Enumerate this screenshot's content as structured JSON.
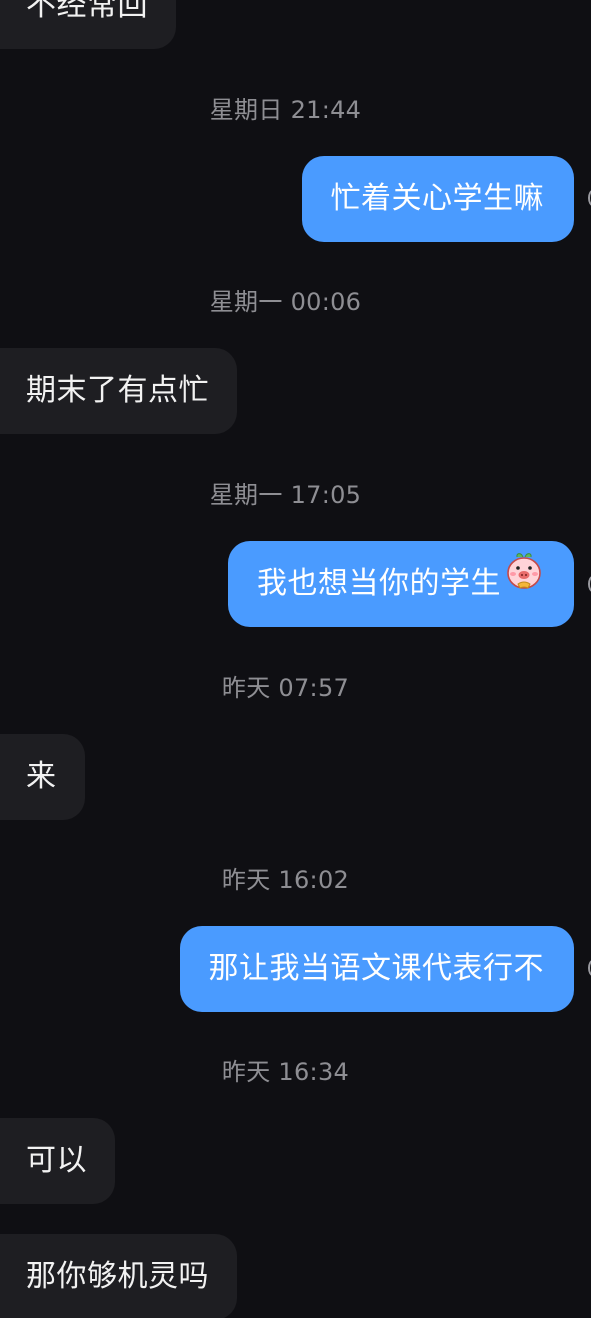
{
  "messages": [
    {
      "type": "incoming",
      "text": "不经常回"
    },
    {
      "type": "timestamp",
      "text": "星期日 21:44"
    },
    {
      "type": "outgoing",
      "text": "忙着关心学生嘛"
    },
    {
      "type": "timestamp",
      "text": "星期一 00:06"
    },
    {
      "type": "incoming",
      "text": "期末了有点忙"
    },
    {
      "type": "timestamp",
      "text": "星期一 17:05"
    },
    {
      "type": "outgoing",
      "text": "我也想当你的学生",
      "emoji": "piglet-sticker-icon"
    },
    {
      "type": "timestamp",
      "text": "昨天 07:57"
    },
    {
      "type": "incoming",
      "text": "来"
    },
    {
      "type": "timestamp",
      "text": "昨天 16:02"
    },
    {
      "type": "outgoing",
      "text": "那让我当语文课代表行不"
    },
    {
      "type": "timestamp",
      "text": "昨天 16:34"
    },
    {
      "type": "incoming",
      "text": "可以"
    },
    {
      "type": "incoming",
      "text": "那你够机灵吗"
    }
  ],
  "colors": {
    "background": "#0f0f13",
    "incoming_bubble": "#1e1e22",
    "outgoing_bubble": "#4a9bff",
    "timestamp_text": "#8e8e93"
  }
}
